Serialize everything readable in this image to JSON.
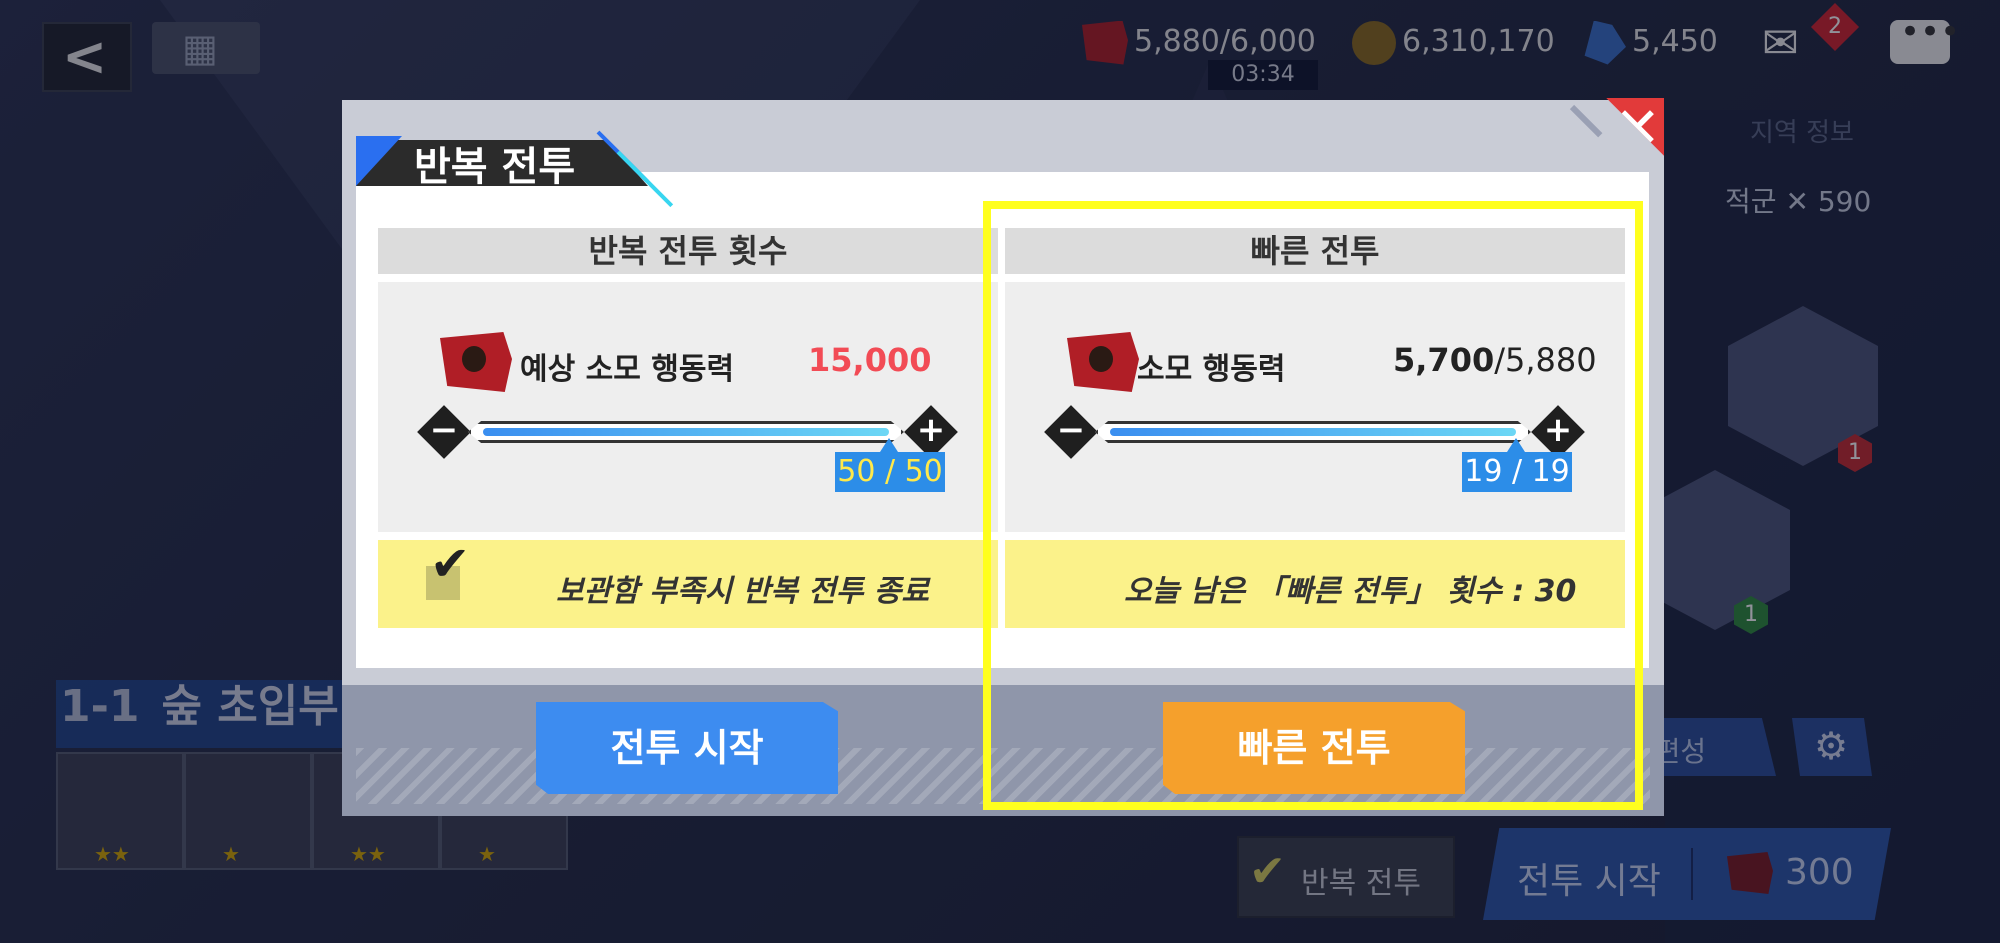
{
  "colors": {
    "accent_blue": "#3d8cf0",
    "accent_orange": "#f5a02c",
    "close_red": "#e23a3a",
    "highlight_yellow": "#ffff1e",
    "strip_yellow": "#fbf28a",
    "cost_red": "#f24b55"
  },
  "top_bar": {
    "action_points": "5,880/6,000",
    "timer": "03:34",
    "gold": "6,310,170",
    "gems": "5,450",
    "mail_badge": "2",
    "icons": [
      "back-arrow-icon",
      "calendar-icon",
      "action-point-flag-icon",
      "gold-coin-icon",
      "blue-gem-icon",
      "mail-icon",
      "chat-icon"
    ]
  },
  "background": {
    "region_info": "지역 정보",
    "recommended_label": "적군",
    "recommended_power": "590",
    "stage_number": "1-1",
    "stage_name": "숲 초입부",
    "formation_button": "동 편성",
    "character_levels": [
      "1",
      "1"
    ],
    "repeat_battle_label": "반복 전투",
    "start_battle_label": "전투 시작",
    "start_cost": "300"
  },
  "modal": {
    "title": "반복 전투",
    "left_panel": {
      "header": "반복 전투 횟수",
      "stat_label": "예상 소모 행동력",
      "stat_value": "15,000",
      "count": "50 / 50",
      "progress": 1.0,
      "strip_text": "보관함 부족시 반복 전투 종료",
      "checkbox_checked": true
    },
    "right_panel": {
      "header": "빠른 전투",
      "stat_label": "소모 행동력",
      "stat_value_main": "5,700",
      "stat_value_total": "/5,880",
      "count": "19 / 19",
      "progress": 1.0,
      "strip_text": "오늘 남은 「빠른 전투」 횟수 : 30"
    },
    "buttons": {
      "start": "전투 시작",
      "quick": "빠른 전투"
    }
  }
}
